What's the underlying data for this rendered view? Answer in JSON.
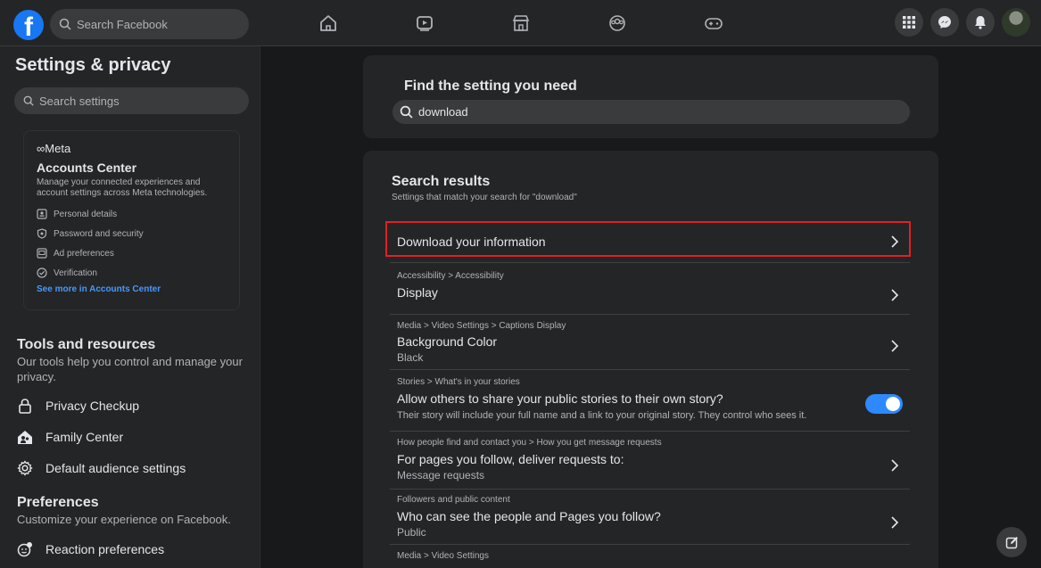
{
  "topbar": {
    "logo_letter": "f",
    "search_placeholder": "Search Facebook",
    "nav_icons": [
      "home-icon",
      "video-icon",
      "marketplace-icon",
      "groups-icon",
      "gaming-icon"
    ],
    "right_icons": [
      "menu-grid-icon",
      "messenger-icon",
      "notifications-icon",
      "avatar"
    ]
  },
  "sidebar": {
    "title": "Settings & privacy",
    "search_placeholder": "Search settings",
    "meta": {
      "logo": "∞Meta",
      "title": "Accounts Center",
      "description": "Manage your connected experiences and account settings across Meta technologies.",
      "items": [
        "Personal details",
        "Password and security",
        "Ad preferences",
        "Verification"
      ],
      "link": "See more in Accounts Center"
    },
    "tools": {
      "title": "Tools and resources",
      "description": "Our tools help you control and manage your privacy.",
      "items": [
        "Privacy Checkup",
        "Family Center",
        "Default audience settings"
      ]
    },
    "preferences": {
      "title": "Preferences",
      "description": "Customize your experience on Facebook.",
      "items": [
        "Reaction preferences"
      ]
    }
  },
  "find": {
    "title": "Find the setting you need",
    "search_value": "download"
  },
  "results": {
    "title": "Search results",
    "subtitle": "Settings that match your search for \"download\"",
    "items": [
      {
        "crumb": "",
        "label": "Download your information",
        "sub": ""
      },
      {
        "crumb": "Accessibility > Accessibility",
        "label": "Display",
        "sub": ""
      },
      {
        "crumb": "Media > Video Settings > Captions Display",
        "label": "Background Color",
        "sub": "Black"
      },
      {
        "crumb": "Stories > What's in your stories",
        "label": "Allow others to share your public stories to their own story?",
        "sub": "Their story will include your full name and a link to your original story. They control who sees it.",
        "toggle_on": true
      },
      {
        "crumb": "How people find and contact you > How you get message requests",
        "label": "For pages you follow, deliver requests to:",
        "sub": "Message requests"
      },
      {
        "crumb": "Followers and public content",
        "label": "Who can see the people and Pages you follow?",
        "sub": "Public"
      },
      {
        "crumb": "Media > Video Settings",
        "label": "",
        "sub": ""
      }
    ]
  },
  "colors": {
    "accent": "#2e89ff",
    "highlight": "#e41e26",
    "background": "#18191a",
    "card": "#242526"
  }
}
